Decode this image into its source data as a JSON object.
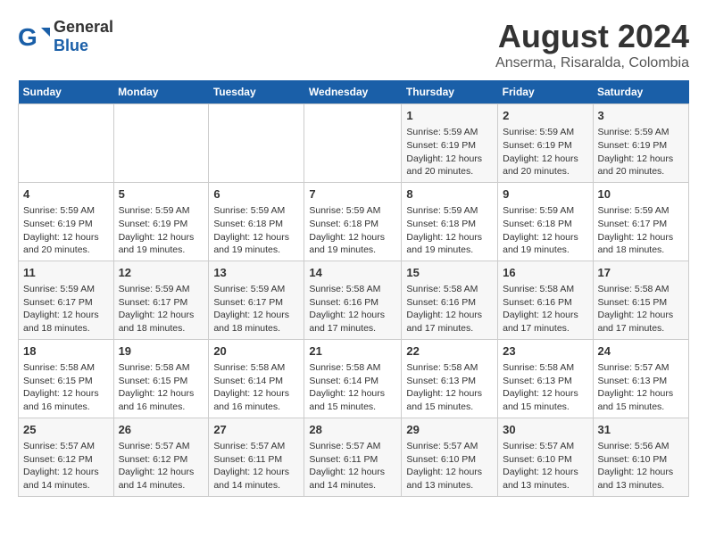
{
  "header": {
    "logo_general": "General",
    "logo_blue": "Blue",
    "month_title": "August 2024",
    "location": "Anserma, Risaralda, Colombia"
  },
  "weekdays": [
    "Sunday",
    "Monday",
    "Tuesday",
    "Wednesday",
    "Thursday",
    "Friday",
    "Saturday"
  ],
  "weeks": [
    [
      {
        "day": "",
        "info": ""
      },
      {
        "day": "",
        "info": ""
      },
      {
        "day": "",
        "info": ""
      },
      {
        "day": "",
        "info": ""
      },
      {
        "day": "1",
        "info": "Sunrise: 5:59 AM\nSunset: 6:19 PM\nDaylight: 12 hours\nand 20 minutes."
      },
      {
        "day": "2",
        "info": "Sunrise: 5:59 AM\nSunset: 6:19 PM\nDaylight: 12 hours\nand 20 minutes."
      },
      {
        "day": "3",
        "info": "Sunrise: 5:59 AM\nSunset: 6:19 PM\nDaylight: 12 hours\nand 20 minutes."
      }
    ],
    [
      {
        "day": "4",
        "info": "Sunrise: 5:59 AM\nSunset: 6:19 PM\nDaylight: 12 hours\nand 20 minutes."
      },
      {
        "day": "5",
        "info": "Sunrise: 5:59 AM\nSunset: 6:19 PM\nDaylight: 12 hours\nand 19 minutes."
      },
      {
        "day": "6",
        "info": "Sunrise: 5:59 AM\nSunset: 6:18 PM\nDaylight: 12 hours\nand 19 minutes."
      },
      {
        "day": "7",
        "info": "Sunrise: 5:59 AM\nSunset: 6:18 PM\nDaylight: 12 hours\nand 19 minutes."
      },
      {
        "day": "8",
        "info": "Sunrise: 5:59 AM\nSunset: 6:18 PM\nDaylight: 12 hours\nand 19 minutes."
      },
      {
        "day": "9",
        "info": "Sunrise: 5:59 AM\nSunset: 6:18 PM\nDaylight: 12 hours\nand 19 minutes."
      },
      {
        "day": "10",
        "info": "Sunrise: 5:59 AM\nSunset: 6:17 PM\nDaylight: 12 hours\nand 18 minutes."
      }
    ],
    [
      {
        "day": "11",
        "info": "Sunrise: 5:59 AM\nSunset: 6:17 PM\nDaylight: 12 hours\nand 18 minutes."
      },
      {
        "day": "12",
        "info": "Sunrise: 5:59 AM\nSunset: 6:17 PM\nDaylight: 12 hours\nand 18 minutes."
      },
      {
        "day": "13",
        "info": "Sunrise: 5:59 AM\nSunset: 6:17 PM\nDaylight: 12 hours\nand 18 minutes."
      },
      {
        "day": "14",
        "info": "Sunrise: 5:58 AM\nSunset: 6:16 PM\nDaylight: 12 hours\nand 17 minutes."
      },
      {
        "day": "15",
        "info": "Sunrise: 5:58 AM\nSunset: 6:16 PM\nDaylight: 12 hours\nand 17 minutes."
      },
      {
        "day": "16",
        "info": "Sunrise: 5:58 AM\nSunset: 6:16 PM\nDaylight: 12 hours\nand 17 minutes."
      },
      {
        "day": "17",
        "info": "Sunrise: 5:58 AM\nSunset: 6:15 PM\nDaylight: 12 hours\nand 17 minutes."
      }
    ],
    [
      {
        "day": "18",
        "info": "Sunrise: 5:58 AM\nSunset: 6:15 PM\nDaylight: 12 hours\nand 16 minutes."
      },
      {
        "day": "19",
        "info": "Sunrise: 5:58 AM\nSunset: 6:15 PM\nDaylight: 12 hours\nand 16 minutes."
      },
      {
        "day": "20",
        "info": "Sunrise: 5:58 AM\nSunset: 6:14 PM\nDaylight: 12 hours\nand 16 minutes."
      },
      {
        "day": "21",
        "info": "Sunrise: 5:58 AM\nSunset: 6:14 PM\nDaylight: 12 hours\nand 15 minutes."
      },
      {
        "day": "22",
        "info": "Sunrise: 5:58 AM\nSunset: 6:13 PM\nDaylight: 12 hours\nand 15 minutes."
      },
      {
        "day": "23",
        "info": "Sunrise: 5:58 AM\nSunset: 6:13 PM\nDaylight: 12 hours\nand 15 minutes."
      },
      {
        "day": "24",
        "info": "Sunrise: 5:57 AM\nSunset: 6:13 PM\nDaylight: 12 hours\nand 15 minutes."
      }
    ],
    [
      {
        "day": "25",
        "info": "Sunrise: 5:57 AM\nSunset: 6:12 PM\nDaylight: 12 hours\nand 14 minutes."
      },
      {
        "day": "26",
        "info": "Sunrise: 5:57 AM\nSunset: 6:12 PM\nDaylight: 12 hours\nand 14 minutes."
      },
      {
        "day": "27",
        "info": "Sunrise: 5:57 AM\nSunset: 6:11 PM\nDaylight: 12 hours\nand 14 minutes."
      },
      {
        "day": "28",
        "info": "Sunrise: 5:57 AM\nSunset: 6:11 PM\nDaylight: 12 hours\nand 14 minutes."
      },
      {
        "day": "29",
        "info": "Sunrise: 5:57 AM\nSunset: 6:10 PM\nDaylight: 12 hours\nand 13 minutes."
      },
      {
        "day": "30",
        "info": "Sunrise: 5:57 AM\nSunset: 6:10 PM\nDaylight: 12 hours\nand 13 minutes."
      },
      {
        "day": "31",
        "info": "Sunrise: 5:56 AM\nSunset: 6:10 PM\nDaylight: 12 hours\nand 13 minutes."
      }
    ]
  ]
}
